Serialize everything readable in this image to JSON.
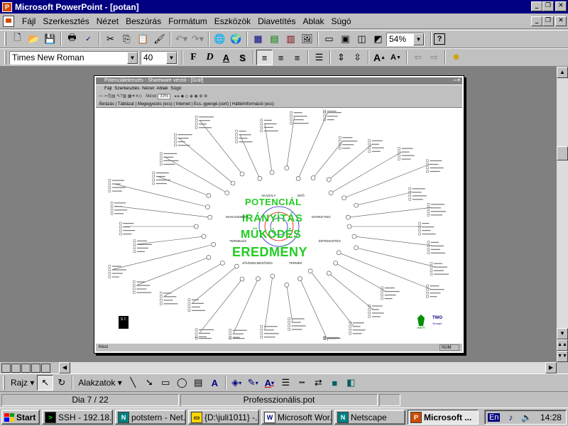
{
  "window": {
    "title": "Microsoft PowerPoint - [potan]",
    "app_icon": "powerpoint-icon"
  },
  "menu": {
    "items": [
      "Fájl",
      "Szerkesztés",
      "Nézet",
      "Beszúrás",
      "Formátum",
      "Eszközök",
      "Diavetítés",
      "Ablak",
      "Súgó"
    ]
  },
  "toolbar1": {
    "zoom": "54%",
    "zoom_options": [
      "54%"
    ]
  },
  "toolbar2": {
    "font_name": "Times New Roman",
    "font_size": "40",
    "bold_label": "F",
    "italic_label": "D",
    "underline_label": "A",
    "shadow_label": "S"
  },
  "slide": {
    "inner_app_title": "Potenciálelemzés - Shareware verzió - [Gráf]",
    "inner_menu": [
      "Fájl",
      "Szerkesztés",
      "Nézet",
      "Ablak",
      "Súgó"
    ],
    "inner_zoom_label": "Méret",
    "inner_zoom": "33%",
    "inner_tabs": [
      "Ábrázás",
      "Táblázat",
      "Megegyezés (ecs)",
      "Internet",
      "Ecs.-gyengé.(sort)",
      "Háttérinformáció (ecs)"
    ],
    "inner_status": "Kész",
    "inner_status_num": "NUM",
    "diagram_words": [
      "POTENCIÁL",
      "IRÁNYÍTÁS",
      "MŰKÖDÉS",
      "EREDMÉNY"
    ],
    "diagram_small_labels": [
      "MANAGEMENT",
      "MARKETING",
      "TERMELÉS",
      "ÉRTÉKESÍTÉS",
      "JÖVEDELMEZŐSÉG",
      "TERMÉK",
      "AKADÁLY",
      "ERŐ"
    ],
    "logo_left": "S.T.",
    "logo_right": "TWO",
    "logo_right_sub": "Europe",
    "logo_mid": "ISETI"
  },
  "drawing": {
    "draw_menu": "Rajz",
    "autoshapes": "Alakzatok"
  },
  "status": {
    "slide": "Dia 7 / 22",
    "template": "Professzionális.pot"
  },
  "taskbar": {
    "start": "Start",
    "tasks": [
      {
        "label": "SSH - 192.18...",
        "icon": "ssh-icon",
        "active": false
      },
      {
        "label": "potstern - Net...",
        "icon": "netscape-icon",
        "active": false
      },
      {
        "label": "{D:\\juli1011} -...",
        "icon": "folder-icon",
        "active": false
      },
      {
        "label": "Microsoft Wor...",
        "icon": "word-icon",
        "active": false
      },
      {
        "label": "Netscape",
        "icon": "netscape-icon",
        "active": false
      },
      {
        "label": "Microsoft ...",
        "icon": "powerpoint-icon",
        "active": true
      }
    ],
    "tray_lang": "En",
    "clock": "14:28"
  }
}
